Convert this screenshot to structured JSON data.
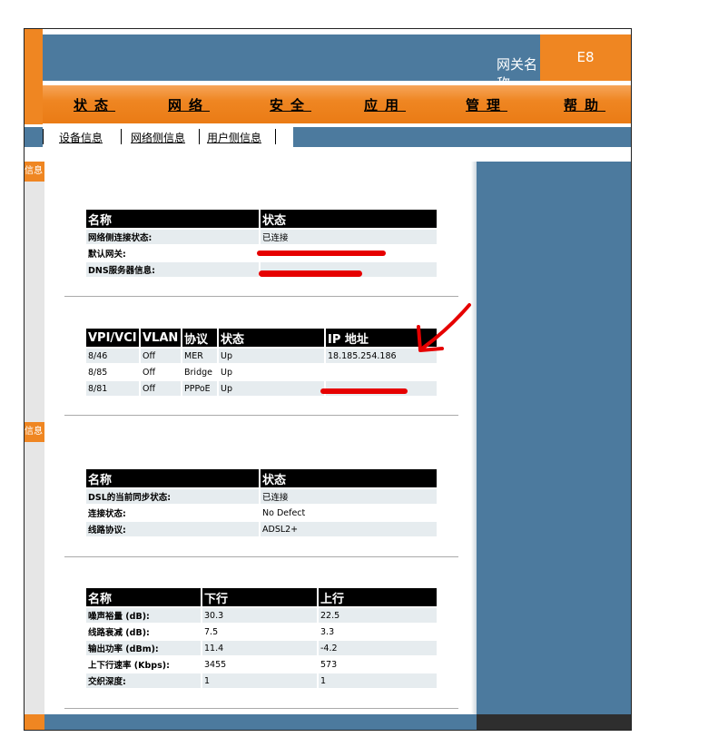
{
  "header": {
    "gateway_label": "网关名称",
    "gateway_value": "E8"
  },
  "nav": {
    "items": [
      {
        "label": "状态"
      },
      {
        "label": "网络"
      },
      {
        "label": "安全"
      },
      {
        "label": "应用"
      },
      {
        "label": "管理"
      },
      {
        "label": "帮助"
      }
    ]
  },
  "subnav": {
    "items": [
      {
        "label": "设备信息"
      },
      {
        "label": "网络侧信息"
      },
      {
        "label": "用户侧信息"
      }
    ]
  },
  "rail": {
    "tab1": "信息",
    "tab2": "信息"
  },
  "table1": {
    "headers": [
      "名称",
      "状态"
    ],
    "rows": [
      [
        "网络侧连接状态:",
        "已连接"
      ],
      [
        "默认网关:",
        ""
      ],
      [
        "DNS服务器信息:",
        ""
      ]
    ]
  },
  "table2": {
    "headers": [
      "VPI/VCI",
      "VLAN",
      "协议",
      "状态",
      "IP 地址"
    ],
    "rows": [
      [
        "8/46",
        "Off",
        "MER",
        "Up",
        "18.185.254.186"
      ],
      [
        "8/85",
        "Off",
        "Bridge",
        "Up",
        ""
      ],
      [
        "8/81",
        "Off",
        "PPPoE",
        "Up",
        ""
      ]
    ]
  },
  "table3": {
    "headers": [
      "名称",
      "状态"
    ],
    "rows": [
      [
        "DSL的当前同步状态:",
        "已连接"
      ],
      [
        "连接状态:",
        "No Defect"
      ],
      [
        "线路协议:",
        "ADSL2+"
      ]
    ]
  },
  "table4": {
    "headers": [
      "名称",
      "下行",
      "上行"
    ],
    "rows": [
      [
        "噪声裕量 (dB):",
        "30.3",
        "22.5"
      ],
      [
        "线路衰减 (dB):",
        "7.5",
        "3.3"
      ],
      [
        "输出功率 (dBm):",
        "11.4",
        "-4.2"
      ],
      [
        "上下行速率 (Kbps):",
        "3455",
        "573"
      ],
      [
        "交织深度:",
        "1",
        "1"
      ]
    ]
  },
  "colors": {
    "orange": "#ef8622",
    "blue": "#4c7a9e",
    "annotation": "#e60000"
  }
}
